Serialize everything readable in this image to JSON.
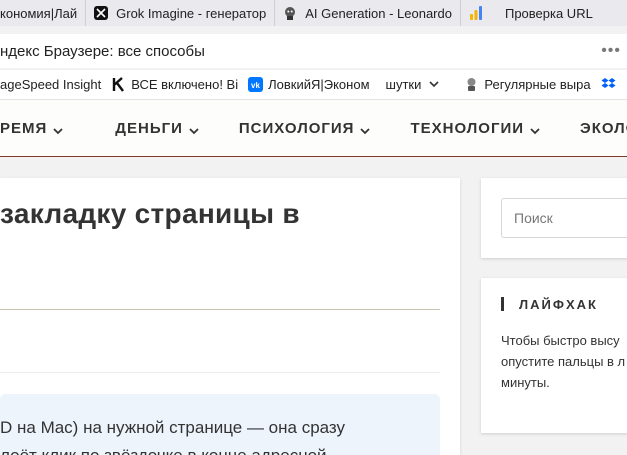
{
  "tabs": [
    {
      "title": "кономия|Лай",
      "icon": "page-icon"
    },
    {
      "title": "Grok Imagine - генератор",
      "icon": "grok-icon"
    },
    {
      "title": "AI Generation - Leonardo",
      "icon": "leonardo-icon"
    },
    {
      "title": "Проверка URL",
      "icon": "analytics-icon"
    }
  ],
  "address": {
    "text": "ндекс Браузере: все способы"
  },
  "bookmarks": [
    {
      "label": "ageSpeed Insight",
      "icon": "pagespeed-icon"
    },
    {
      "label": "ВСЕ включено! Ві",
      "icon": "k-logo-icon"
    },
    {
      "label": "ЛовкийЯ|Эконом",
      "icon": "vk-icon"
    },
    {
      "label": "шутки",
      "icon": "chevron-down-icon"
    },
    {
      "label": "Регулярные выра",
      "icon": "regex-icon"
    },
    {
      "label": "",
      "icon": "dropbox-icon"
    }
  ],
  "nav": {
    "items": [
      "РЕМЯ",
      "ДЕНЬГИ",
      "ПСИХОЛОГИЯ",
      "ТЕХНОЛОГИИ",
      "ЭКОЛОГИЯ"
    ]
  },
  "article": {
    "title": "закладку страницы в",
    "hint_line1": "D на Mac) на нужной странице — она сразу",
    "hint_line2": "лоёт клик по звёздочке в конце адресной"
  },
  "sidebar": {
    "search_placeholder": "Поиск",
    "tip": {
      "title": "ЛАЙФХАК",
      "lines": [
        "Чтобы быстро высу",
        "опустите пальцы в л",
        "минуты."
      ]
    }
  },
  "colors": {
    "nav_border": "#7a3b2e",
    "hint_bg": "#eef4fc",
    "vk": "#0077ff",
    "dropbox": "#0061fe"
  }
}
